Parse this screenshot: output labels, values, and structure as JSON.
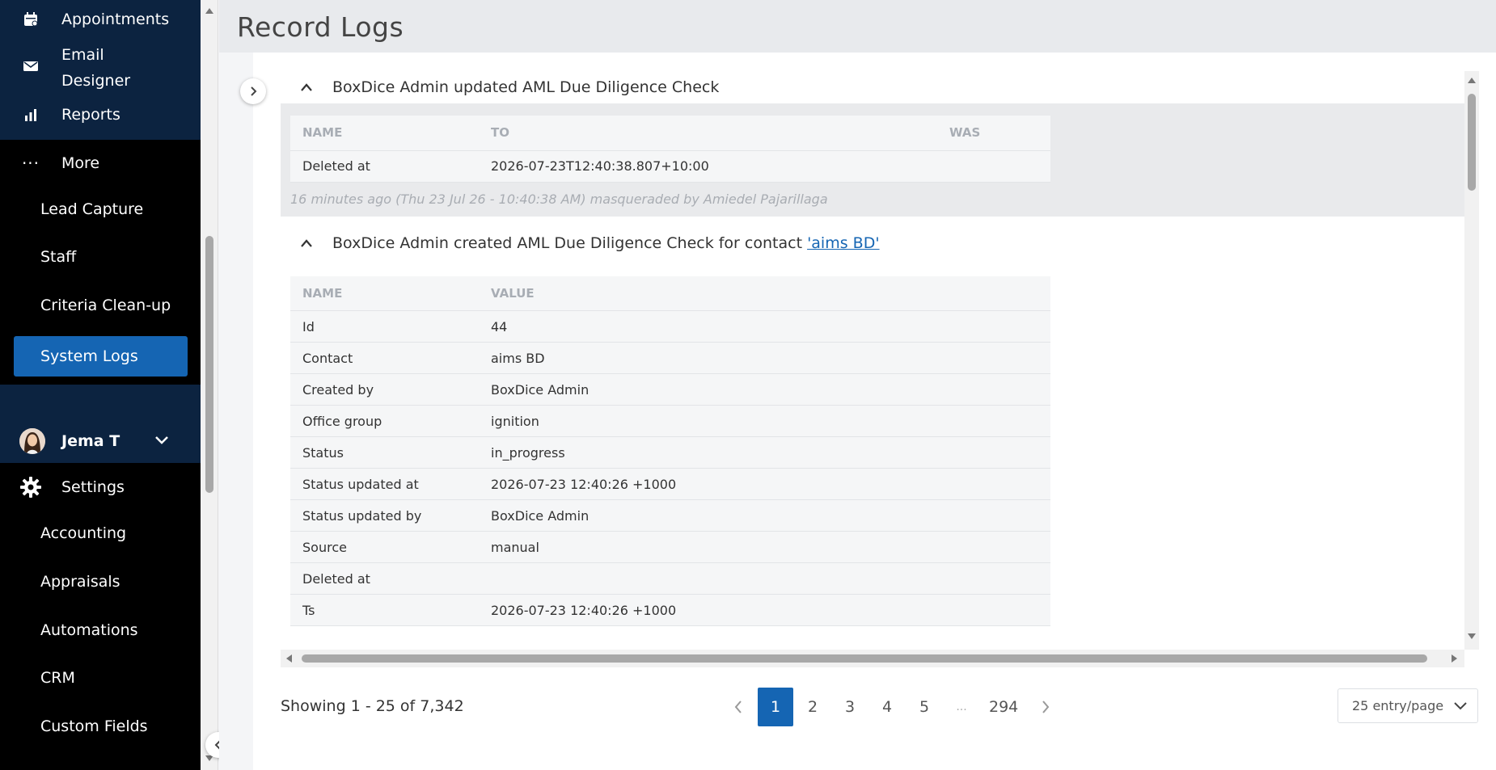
{
  "sidebar": {
    "appointments": "Appointments",
    "email_designer": "Email\nDesigner",
    "reports": "Reports",
    "more": "More",
    "items": [
      "Lead Capture",
      "Staff",
      "Criteria Clean-up"
    ],
    "active_item": "System Logs",
    "user_name": "Jema T",
    "settings": "Settings",
    "settings_items": [
      "Accounting",
      "Appraisals",
      "Automations",
      "CRM",
      "Custom Fields"
    ]
  },
  "page": {
    "title": "Record Logs"
  },
  "entries": [
    {
      "summary": "BoxDice Admin updated AML Due Diligence Check",
      "headers": [
        "NAME",
        "TO",
        "WAS"
      ],
      "rows": [
        [
          "Deleted at",
          "2026-07-23T12:40:38.807+10:00",
          ""
        ]
      ],
      "meta": "16 minutes ago (Thu 23 Jul 26 - 10:40:38 AM) masqueraded by Amiedel Pajarillaga"
    },
    {
      "summary_prefix": "BoxDice Admin created AML Due Diligence Check for contact ",
      "summary_link": "'aims BD'",
      "headers": [
        "NAME",
        "VALUE"
      ],
      "rows": [
        [
          "Id",
          "44"
        ],
        [
          "Contact",
          "aims BD"
        ],
        [
          "Created by",
          "BoxDice Admin"
        ],
        [
          "Office group",
          "ignition"
        ],
        [
          "Status",
          "in_progress"
        ],
        [
          "Status updated at",
          "2026-07-23 12:40:26 +1000"
        ],
        [
          "Status updated by",
          "BoxDice Admin"
        ],
        [
          "Source",
          "manual"
        ],
        [
          "Deleted at",
          ""
        ],
        [
          "Ts",
          "2026-07-23 12:40:26 +1000"
        ]
      ]
    }
  ],
  "pagination": {
    "showing": "Showing 1 - 25 of 7,342",
    "pages": [
      "1",
      "2",
      "3",
      "4",
      "5",
      "...",
      "294"
    ],
    "current": "1",
    "per_page": "25 entry/page"
  },
  "colors": {
    "accent": "#1565b3",
    "sidebar_dark": "#0c2340"
  }
}
